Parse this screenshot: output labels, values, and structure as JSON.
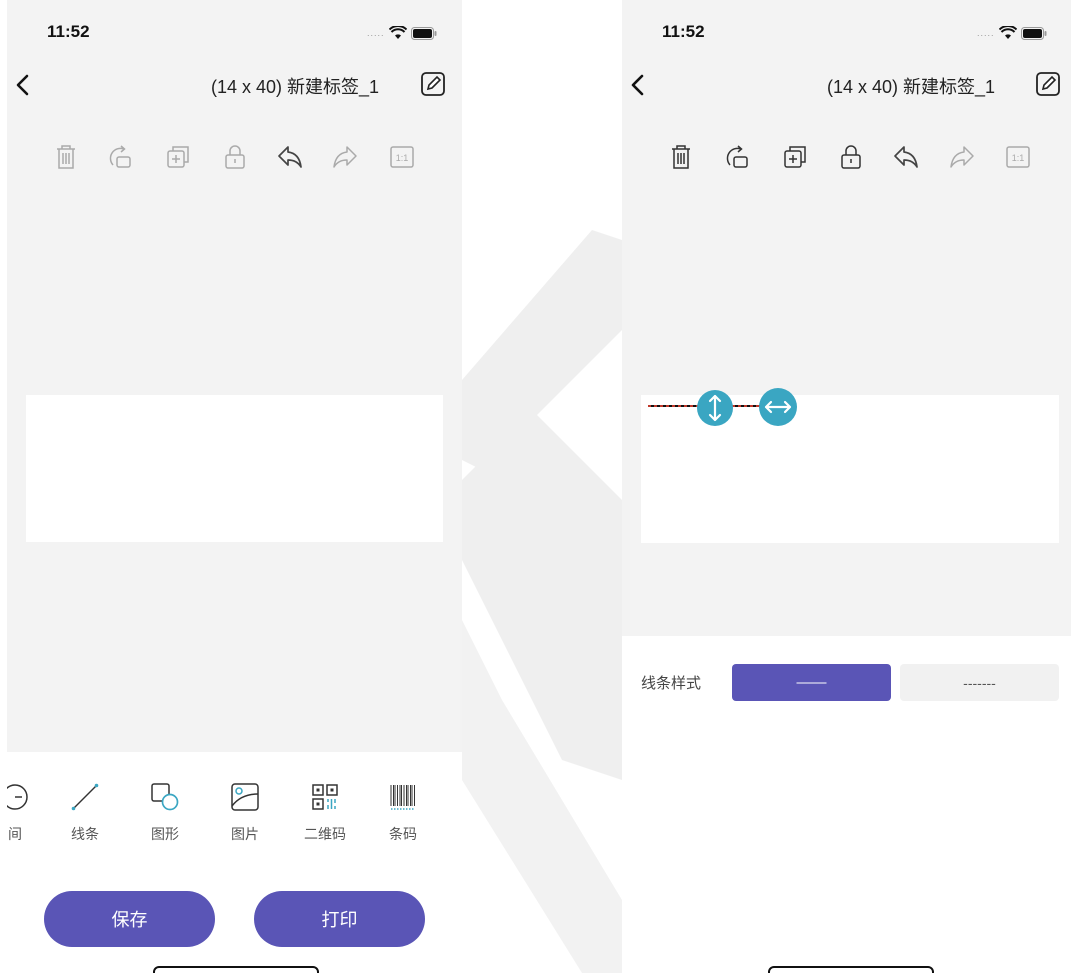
{
  "left_screen": {
    "status": {
      "time": "11:52"
    },
    "header": {
      "title": "(14 x 40) 新建标签_1"
    },
    "toolbar": [
      "trash-icon",
      "rotate-icon",
      "duplicate-icon",
      "lock-icon",
      "undo-icon",
      "redo-icon",
      "one-to-one-icon"
    ],
    "tools": [
      {
        "label": "间",
        "icon": "time-icon"
      },
      {
        "label": "线条",
        "icon": "line-icon"
      },
      {
        "label": "图形",
        "icon": "shape-icon"
      },
      {
        "label": "图片",
        "icon": "image-icon"
      },
      {
        "label": "二维码",
        "icon": "qrcode-icon"
      },
      {
        "label": "条码",
        "icon": "barcode-icon"
      }
    ],
    "actions": {
      "save": "保存",
      "print": "打印"
    }
  },
  "right_screen": {
    "status": {
      "time": "11:52"
    },
    "header": {
      "title": "(14 x 40) 新建标签_1"
    },
    "line_style": {
      "label": "线条样式",
      "solid": "——",
      "dashed": "-------",
      "selected": "solid"
    }
  },
  "colors": {
    "accent": "#5a55b6",
    "handle": "#3aa6c2",
    "canvas_bg": "#f3f3f3",
    "line_red": "#c0392b"
  }
}
